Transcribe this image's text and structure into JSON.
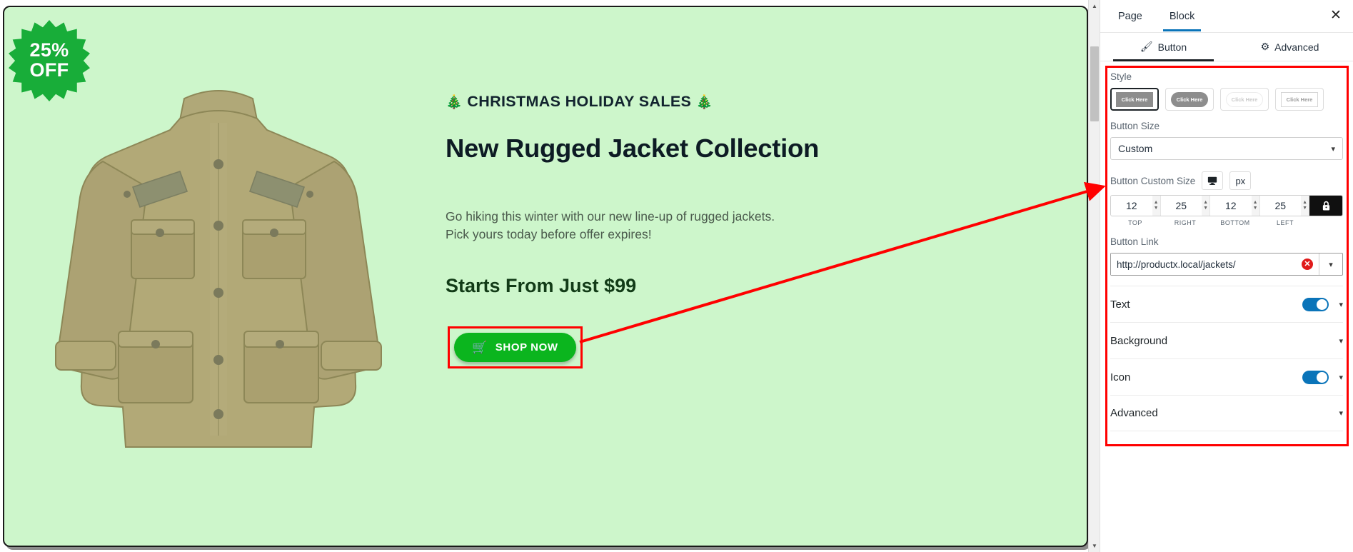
{
  "hero": {
    "badge": {
      "percent": "25%",
      "off": "OFF"
    },
    "eyebrow_left_icon": "christmas-tree",
    "eyebrow": "CHRISTMAS HOLIDAY SALES",
    "eyebrow_right_icon": "christmas-tree",
    "headline": "New Rugged Jacket Collection",
    "paragraph_line1": "Go hiking this winter with our new line-up of rugged jackets.",
    "paragraph_line2": "Pick yours today before offer expires!",
    "price": "Starts From Just $99",
    "cta_label": "SHOP NOW",
    "cta_icon": "shopping-cart",
    "bg_color": "#cdf6cb",
    "cta_color": "#0bb51e",
    "highlight_color": "#ff0000"
  },
  "panel": {
    "tabs": [
      {
        "label": "Page",
        "active": false
      },
      {
        "label": "Block",
        "active": true
      }
    ],
    "close_icon": "close-icon",
    "subtabs": [
      {
        "label": "Button",
        "icon": "brush-icon",
        "active": true
      },
      {
        "label": "Advanced",
        "icon": "gear-icon",
        "active": false
      }
    ],
    "style": {
      "label": "Style",
      "options": [
        {
          "preview_label": "Click Here",
          "shape": "rect-filled",
          "selected": true
        },
        {
          "preview_label": "Click Here",
          "shape": "pill-filled",
          "selected": false
        },
        {
          "preview_label": "Click Here",
          "shape": "pill-outline",
          "selected": false
        },
        {
          "preview_label": "Click Here",
          "shape": "rect-outline",
          "selected": false
        }
      ]
    },
    "button_size": {
      "label": "Button Size",
      "value": "Custom"
    },
    "custom_size": {
      "label": "Button Custom Size",
      "device_icon": "desktop-icon",
      "unit": "px",
      "fields": [
        {
          "value": "12",
          "caption": "TOP"
        },
        {
          "value": "25",
          "caption": "RIGHT"
        },
        {
          "value": "12",
          "caption": "BOTTOM"
        },
        {
          "value": "25",
          "caption": "LEFT"
        }
      ],
      "lock_icon": "lock-icon"
    },
    "button_link": {
      "label": "Button Link",
      "value": "http://productx.local/jackets/",
      "clear_icon": "clear-circle-icon",
      "expand_icon": "chevron-down-icon"
    },
    "accordion": [
      {
        "label": "Text",
        "toggle": true,
        "toggle_on": true
      },
      {
        "label": "Background",
        "toggle": false,
        "toggle_on": false
      },
      {
        "label": "Icon",
        "toggle": true,
        "toggle_on": true
      },
      {
        "label": "Advanced",
        "toggle": false,
        "toggle_on": false
      }
    ],
    "accent_color": "#0a74b9"
  }
}
